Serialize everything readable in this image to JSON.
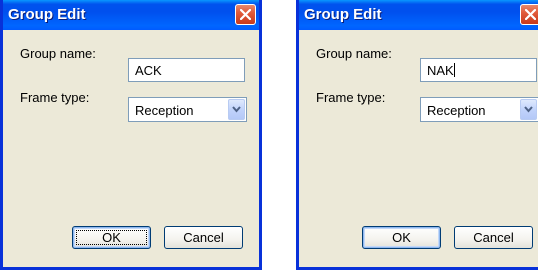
{
  "colors": {
    "titlebar": "#0054e3",
    "dialog_face": "#ece9d8",
    "close_red": "#e15a3a",
    "field_border": "#7f9db9"
  },
  "dialogs": [
    {
      "title": "Group Edit",
      "group_name_label": "Group name:",
      "group_name_value": "ACK",
      "frame_type_label": "Frame type:",
      "frame_type_value": "Reception",
      "ok_label": "OK",
      "cancel_label": "Cancel"
    },
    {
      "title": "Group Edit",
      "group_name_label": "Group name:",
      "group_name_value": "NAK",
      "frame_type_label": "Frame type:",
      "frame_type_value": "Reception",
      "ok_label": "OK",
      "cancel_label": "Cancel"
    }
  ],
  "icons": {
    "close": "close-icon",
    "dropdown": "chevron-down-icon"
  }
}
